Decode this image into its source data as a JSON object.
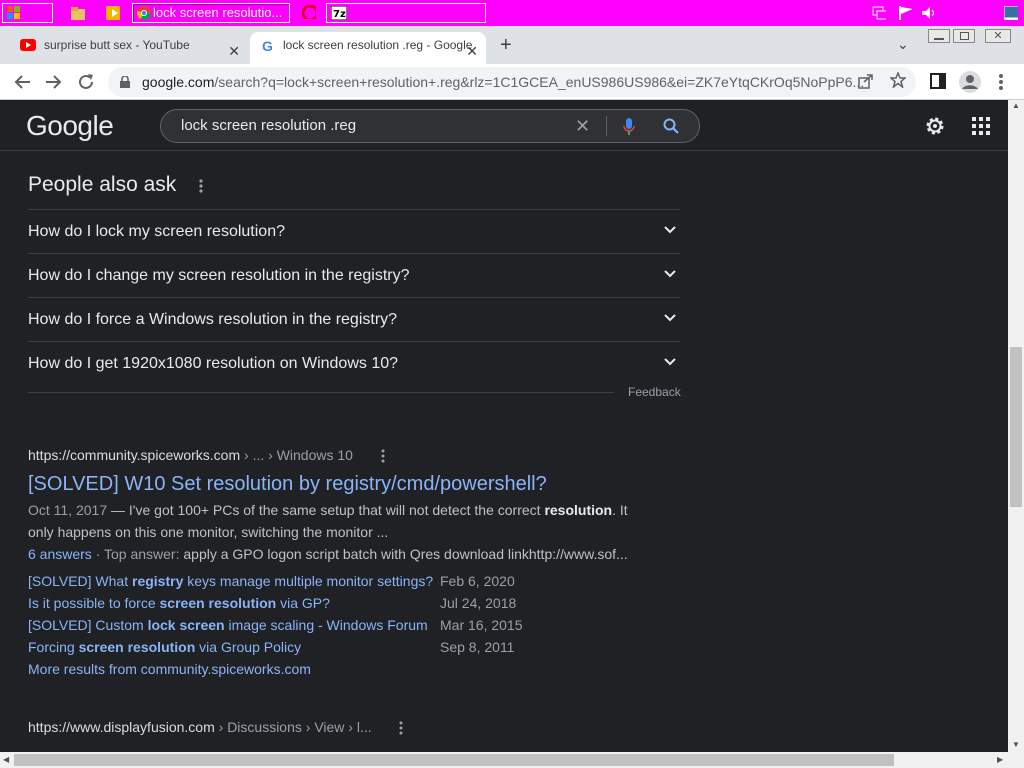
{
  "taskbar": {
    "active_window": "lock screen resolutio...",
    "colors": {
      "bg": "#ff00ff"
    }
  },
  "tabs": [
    {
      "label": "surprise butt sex - YouTube",
      "icon": "youtube-icon"
    },
    {
      "label": "lock screen resolution .reg - Google",
      "icon": "google-icon"
    }
  ],
  "address": {
    "host": "google.com",
    "path": "/search?q=lock+screen+resolution+.reg&rlz=1C1GCEA_enUS986US986&ei=ZK7eYtqCKrOq5NoPpP6..."
  },
  "search": {
    "logo": "Google",
    "query": "lock screen resolution .reg"
  },
  "paa": {
    "title": "People also ask",
    "questions": [
      "How do I lock my screen resolution?",
      "How do I change my screen resolution in the registry?",
      "How do I force a Windows resolution in the registry?",
      "How do I get 1920x1080 resolution on Windows 10?"
    ],
    "feedback": "Feedback"
  },
  "result1": {
    "url": "https://community.spiceworks.com",
    "breadcrumb": " › ... › Windows 10",
    "title": "[SOLVED] W10 Set resolution by registry/cmd/powershell?",
    "date": "Oct 11, 2017",
    "snippet_a": " — I've got 100+ PCs of the same setup that will not detect the correct ",
    "snippet_bold": "resolution",
    "snippet_b": ". It only happens on this one monitor, switching the monitor ...",
    "answers": "6 answers",
    "top_answer_label": " · Top answer: ",
    "top_answer": "apply a GPO logon script batch with Qres download linkhttp://www.sof...",
    "sublinks": [
      {
        "pre": "[SOLVED] What ",
        "bold": "registry",
        "post": " keys manage multiple monitor settings?",
        "date": "Feb 6, 2020"
      },
      {
        "pre": "Is it possible to force ",
        "bold": "screen resolution",
        "post": " via GP?",
        "date": "Jul 24, 2018"
      },
      {
        "pre": "[SOLVED] Custom ",
        "bold": "lock screen",
        "post": " image scaling - Windows Forum",
        "date": "Mar 16, 2015"
      },
      {
        "pre": "Forcing ",
        "bold": "screen resolution",
        "post": " via Group Policy",
        "date": "Sep 8, 2011"
      }
    ],
    "more": "More results from community.spiceworks.com"
  },
  "result2": {
    "url": "https://www.displayfusion.com",
    "breadcrumb": " › Discussions › View › l..."
  },
  "colors": {
    "page_bg": "#202124",
    "link": "#8ab4f8",
    "text": "#e8eaed",
    "muted": "#9aa0a6"
  }
}
